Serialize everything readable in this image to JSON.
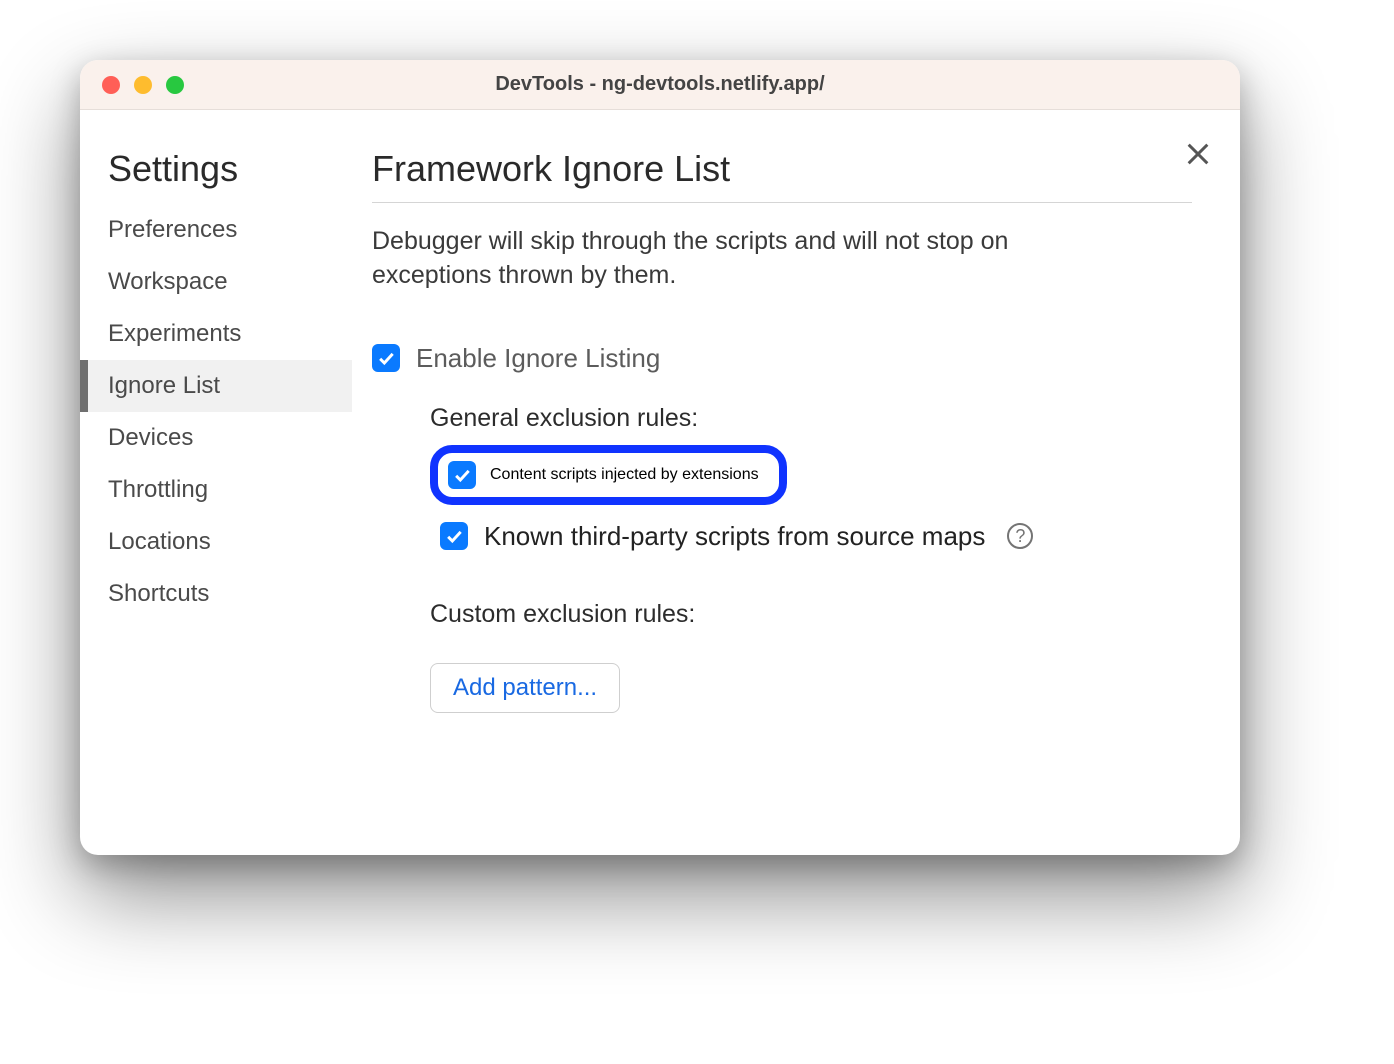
{
  "window": {
    "title": "DevTools - ng-devtools.netlify.app/"
  },
  "sidebar": {
    "heading": "Settings",
    "items": [
      {
        "label": "Preferences",
        "active": false
      },
      {
        "label": "Workspace",
        "active": false
      },
      {
        "label": "Experiments",
        "active": false
      },
      {
        "label": "Ignore List",
        "active": true
      },
      {
        "label": "Devices",
        "active": false
      },
      {
        "label": "Throttling",
        "active": false
      },
      {
        "label": "Locations",
        "active": false
      },
      {
        "label": "Shortcuts",
        "active": false
      }
    ]
  },
  "main": {
    "heading": "Framework Ignore List",
    "description": "Debugger will skip through the scripts and will not stop on exceptions thrown by them.",
    "enable_label": "Enable Ignore Listing",
    "enable_checked": true,
    "general_heading": "General exclusion rules:",
    "rules": [
      {
        "label": "Content scripts injected by extensions",
        "checked": true,
        "highlighted": true,
        "help": false
      },
      {
        "label": "Known third-party scripts from source maps",
        "checked": true,
        "highlighted": false,
        "help": true
      }
    ],
    "custom_heading": "Custom exclusion rules:",
    "add_pattern_label": "Add pattern..."
  }
}
